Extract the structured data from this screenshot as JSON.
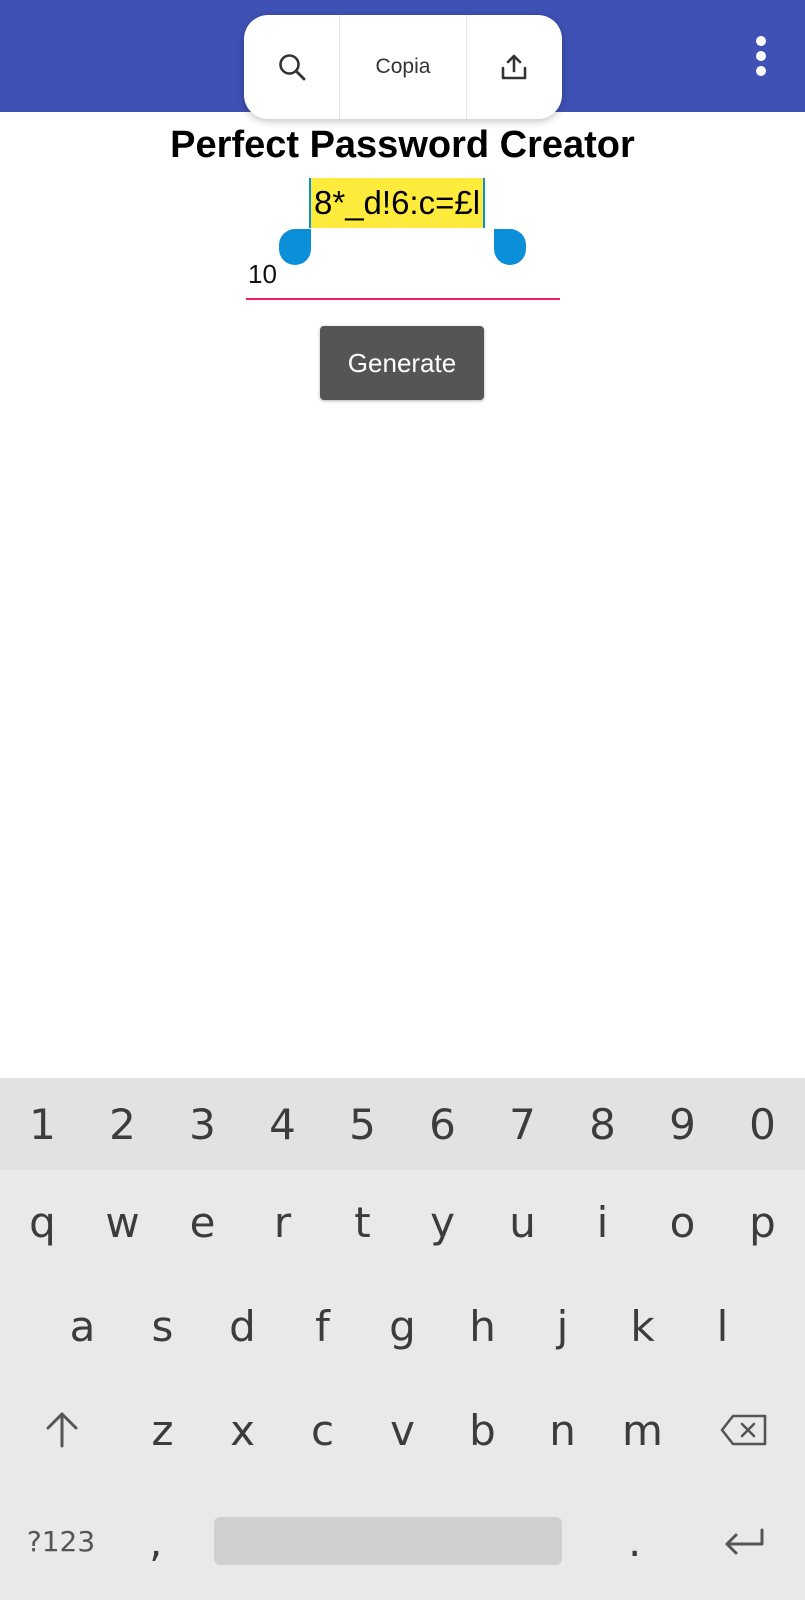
{
  "app_bar": {
    "color": "#3f51b5",
    "menu_icon": "more-vert-icon"
  },
  "selection_toolbar": {
    "search_icon": "search-icon",
    "copy_label": "Copia",
    "share_icon": "share-icon"
  },
  "title": "Perfect Password Creator",
  "password": "8*_d!6:c=£l",
  "length_value": "10",
  "generate_label": "Generate",
  "keyboard": {
    "numbers": [
      "1",
      "2",
      "3",
      "4",
      "5",
      "6",
      "7",
      "8",
      "9",
      "0"
    ],
    "row1": [
      "q",
      "w",
      "e",
      "r",
      "t",
      "y",
      "u",
      "i",
      "o",
      "p"
    ],
    "row2": [
      "a",
      "s",
      "d",
      "f",
      "g",
      "h",
      "j",
      "k",
      "l"
    ],
    "row3": [
      "z",
      "x",
      "c",
      "v",
      "b",
      "n",
      "m"
    ],
    "symbols_label": "?123",
    "comma": ",",
    "period": ".",
    "shift_icon": "shift-arrow-icon",
    "backspace_icon": "backspace-icon",
    "enter_icon": "enter-icon"
  },
  "colors": {
    "accent": "#3f51b5",
    "selection_highlight": "#ffeb3b",
    "selection_handle": "#0a8fd8",
    "field_underline": "#e91e63",
    "button": "#555555"
  }
}
